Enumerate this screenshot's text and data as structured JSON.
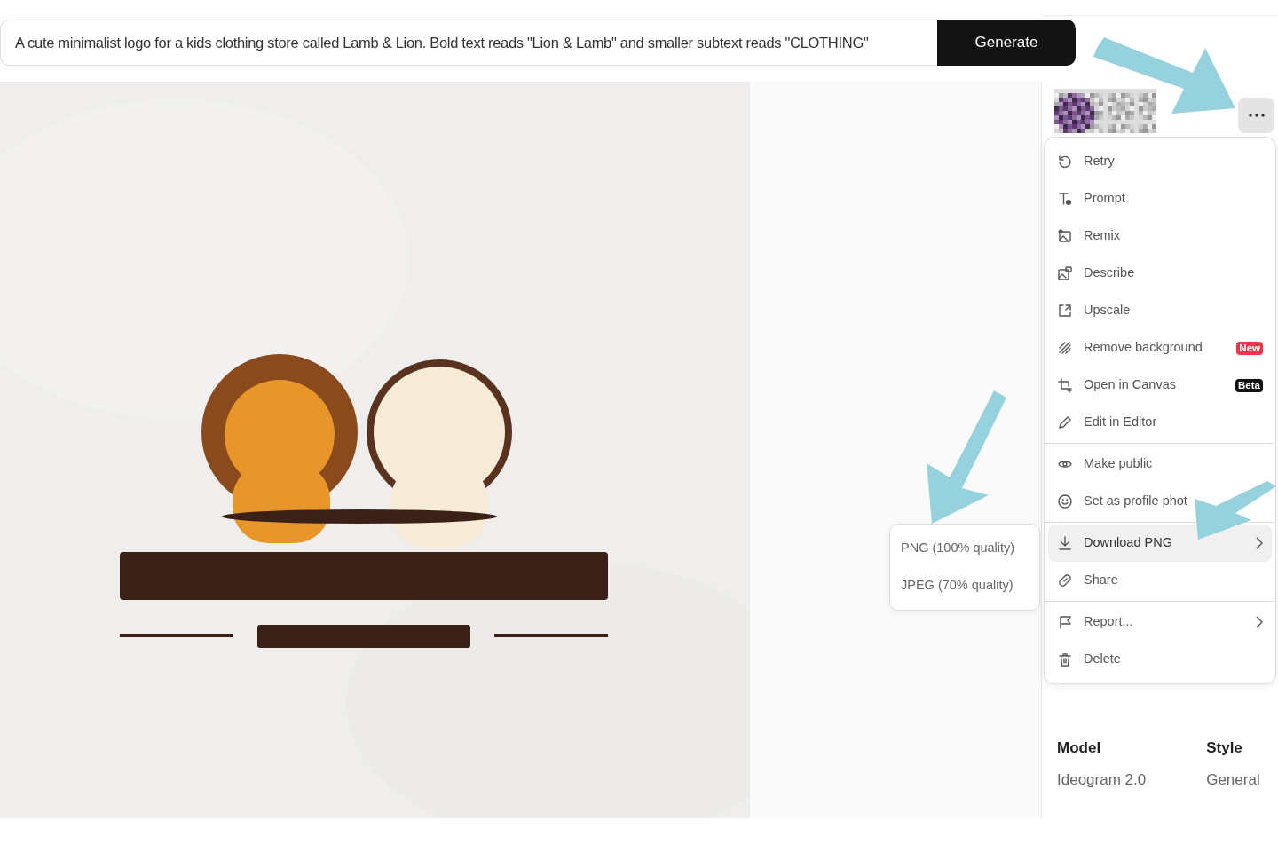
{
  "prompt": {
    "value": "A cute minimalist logo for a kids clothing store called Lamb & Lion. Bold text reads \"Lion & Lamb\" and smaller subtext reads \"CLOTHING\""
  },
  "generate_button": "Generate",
  "menu": {
    "groups": [
      [
        {
          "label": "Retry",
          "submenu": false,
          "selected": false
        },
        {
          "label": "Prompt",
          "submenu": false,
          "selected": false
        },
        {
          "label": "Remix",
          "submenu": false,
          "selected": false
        },
        {
          "label": "Describe",
          "submenu": false,
          "selected": false
        },
        {
          "label": "Upscale",
          "submenu": false,
          "selected": false
        },
        {
          "label": "Remove background",
          "submenu": false,
          "selected": false,
          "badge": {
            "text": "New",
            "kind": "new"
          }
        },
        {
          "label": "Open in Canvas",
          "submenu": false,
          "selected": false,
          "badge": {
            "text": "Beta",
            "kind": "beta"
          }
        },
        {
          "label": "Edit in Editor",
          "submenu": false,
          "selected": false
        }
      ],
      [
        {
          "label": "Make public",
          "submenu": false,
          "selected": false
        },
        {
          "label": "Set as profile phot",
          "submenu": false,
          "selected": false
        }
      ],
      [
        {
          "label": "Download PNG",
          "submenu": true,
          "selected": true
        },
        {
          "label": "Share",
          "submenu": false,
          "selected": false
        }
      ],
      [
        {
          "label": "Report...",
          "submenu": true,
          "selected": false
        },
        {
          "label": "Delete",
          "submenu": false,
          "selected": false
        }
      ]
    ]
  },
  "submenu": [
    "PNG (100% quality)",
    "JPEG (70% quality)"
  ],
  "details": [
    {
      "label": "Model",
      "value": "Ideogram 2.0"
    },
    {
      "label": "Style",
      "value": "General"
    }
  ]
}
